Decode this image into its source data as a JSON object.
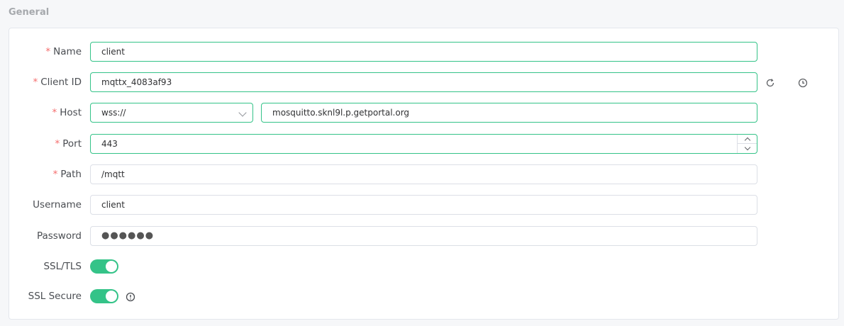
{
  "section": {
    "title": "General"
  },
  "form": {
    "name": {
      "label": "Name",
      "required": "*",
      "value": "client"
    },
    "client_id": {
      "label": "Client ID",
      "required": "*",
      "value": "mqttx_4083af93"
    },
    "host": {
      "label": "Host",
      "required": "*",
      "protocol": "wss://",
      "value": "mosquitto.sknl9l.p.getportal.org"
    },
    "port": {
      "label": "Port",
      "required": "*",
      "value": "443"
    },
    "path": {
      "label": "Path",
      "required": "*",
      "value": "/mqtt"
    },
    "username": {
      "label": "Username",
      "value": "client"
    },
    "password": {
      "label": "Password",
      "value": "●●●●●●"
    },
    "ssl_tls": {
      "label": "SSL/TLS",
      "enabled": true
    },
    "ssl_secure": {
      "label": "SSL Secure",
      "enabled": true
    }
  },
  "icons": {
    "refresh": "refresh-icon",
    "history": "clock-icon",
    "info": "info-icon"
  },
  "colors": {
    "accent": "#34c388",
    "required": "#f56c6c"
  }
}
